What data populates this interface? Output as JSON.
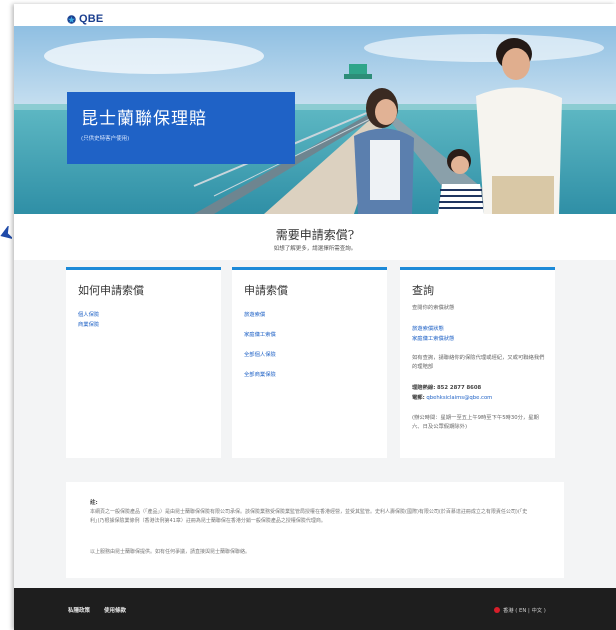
{
  "header": {
    "logo_text": "QBE"
  },
  "hero": {
    "title": "昆士蘭聯保理賠",
    "subtitle": "(只供史特客户使用)"
  },
  "intro": {
    "title": "需要申請索償?",
    "subtitle": "如想了解更多，請選擇所需查詢。"
  },
  "cards": [
    {
      "title": "如何申請索償",
      "links": [
        "個人保險",
        "商業保險"
      ]
    },
    {
      "title": "申請索償",
      "links": [
        "旅遊索償",
        "家庭傭工索償",
        "全部個人保險",
        "全部商業保險"
      ]
    },
    {
      "title": "查詢",
      "status_text": "查閱你的索償狀態",
      "links": [
        "旅遊索償狀態",
        "家庭傭工索償狀態"
      ],
      "agent_text": "如有查詢，請聯絡你的保險代理或經紀，又或可聯絡我們的理賠部",
      "hotline_label": "理賠熱線:",
      "hotline": "852 2877 8608",
      "email_label": "電郵:",
      "email": "qbehksiclaims@qbe.com",
      "hours": "(辦公時間：星期一至五上午9時至下午5時30分，星期六、日及公眾假期除外)"
    }
  ],
  "notes": {
    "label": "註:",
    "p1": "本網頁之一般保險產品（「產品」）是由昆士蘭聯保保險有限公司承保。該保險業務受保險業監管局授權在香港經營，並受其監管。史利人壽保險(國際)有限公司(於百慕達註冊成立之有限責任公司)(「史利」)乃根據保險業條例（香港法例第41章）註冊為昆士蘭聯保在香港分銷一般保險產品之授權保險代理商。",
    "p2": "以上服務由昆士蘭聯保提供。如有任何爭議，請直接與昆士蘭聯保聯絡。"
  },
  "footer": {
    "privacy": "私隱政策",
    "terms": "使用條款",
    "region": "香港 ( EN | 中文 )"
  },
  "colors": {
    "brand_blue": "#1f62c6",
    "card_accent": "#1c8ad8",
    "footer_bg": "#1e1e1e"
  }
}
